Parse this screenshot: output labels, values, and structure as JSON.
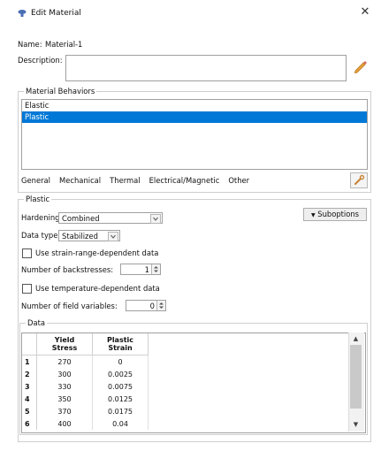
{
  "window": {
    "title": "Edit Material",
    "close_glyph": "✕"
  },
  "name": {
    "label": "Name:",
    "value": "Material-1"
  },
  "description": {
    "label": "Description:",
    "value": ""
  },
  "behaviors": {
    "group_label": "Material Behaviors",
    "items": [
      {
        "label": "Elastic",
        "selected": false
      },
      {
        "label": "Plastic",
        "selected": true
      }
    ]
  },
  "menu": {
    "items": [
      "General",
      "Mechanical",
      "Thermal",
      "Electrical/Magnetic",
      "Other"
    ]
  },
  "plastic": {
    "group_label": "Plastic",
    "hardening_label": "Hardening:",
    "hardening_value": "Combined",
    "data_type_label": "Data type:",
    "data_type_value": "Stabilized",
    "suboptions_label": "Suboptions",
    "use_strain_range_label": "Use strain-range-dependent data",
    "backstresses_label": "Number of backstresses:",
    "backstresses_value": "1",
    "use_temp_label": "Use temperature-dependent data",
    "field_vars_label": "Number of field variables:",
    "field_vars_value": "0"
  },
  "data_table": {
    "group_label": "Data",
    "columns": [
      {
        "line1": "Yield",
        "line2": "Stress"
      },
      {
        "line1": "Plastic",
        "line2": "Strain"
      }
    ],
    "rows": [
      {
        "n": "1",
        "stress": "270",
        "strain": "0"
      },
      {
        "n": "2",
        "stress": "300",
        "strain": "0.0025"
      },
      {
        "n": "3",
        "stress": "330",
        "strain": "0.0075"
      },
      {
        "n": "4",
        "stress": "350",
        "strain": "0.0125"
      },
      {
        "n": "5",
        "stress": "370",
        "strain": "0.0175"
      },
      {
        "n": "6",
        "stress": "400",
        "strain": "0.04"
      }
    ]
  },
  "colors": {
    "selection": "#0078d7",
    "title_icon": "#4a6fb5"
  },
  "icons": [
    "material-app-icon",
    "close-icon",
    "pencil-icon",
    "wrench-icon",
    "chevron-down-icon",
    "spinner-icon",
    "triangle-down-icon",
    "scroll-up-icon",
    "scroll-down-icon"
  ]
}
